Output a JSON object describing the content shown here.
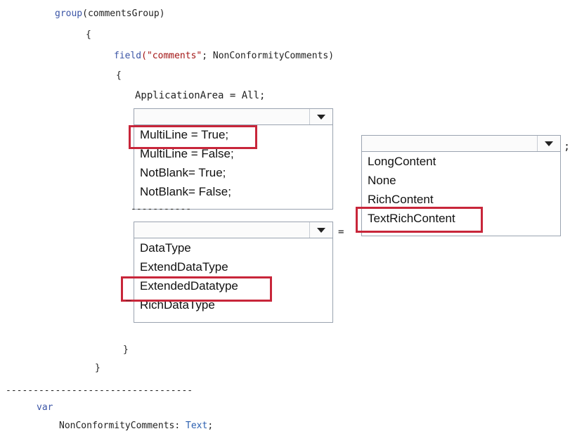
{
  "code": {
    "line1_kw": "group",
    "line1_rest": "(commentsGroup)",
    "brace_open_1": "{",
    "line3_kw": "field",
    "line3_str": "(\"comments\"",
    "line3_rest": "; NonConformityComments)",
    "brace_open_2": "{",
    "line5": "ApplicationArea = All;",
    "eq_sign": "=",
    "semicolon": ";",
    "brace_close_2": "}",
    "brace_close_1": "}",
    "separator": "----------------------------------",
    "var_kw": "var",
    "decl_name": "NonConformityComments: ",
    "decl_type": "Text",
    "decl_end": ";",
    "dropdown1_trail": "-----------",
    "dropdown3_trail": "_"
  },
  "dropdown1": {
    "options": [
      "MultiLine = True;",
      "MultiLine = False;",
      "NotBlank= True;",
      "NotBlank= False;"
    ],
    "selected_index": 0
  },
  "dropdown2": {
    "options": [
      "DataType",
      "ExtendDataType",
      "ExtendedDatatype",
      "RichDataType"
    ],
    "selected_index": 2
  },
  "dropdown3": {
    "options": [
      "LongContent",
      "None",
      "RichContent",
      "TextRichContent"
    ],
    "selected_index": 3
  },
  "colors": {
    "highlight": "#c8263a",
    "keyword": "#3b55a6"
  }
}
